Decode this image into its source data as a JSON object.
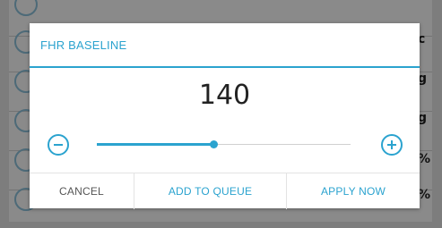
{
  "dialog": {
    "title": "FHR BASELINE",
    "value": "140",
    "slider_fraction": 0.46,
    "minus_icon": "minus-circle-icon",
    "plus_icon": "plus-circle-icon",
    "actions": {
      "cancel": "CANCEL",
      "add_to_queue": "ADD TO QUEUE",
      "apply_now": "APPLY NOW"
    }
  },
  "background": {
    "units": [
      "c",
      "g",
      "g",
      "%",
      "%"
    ]
  },
  "colors": {
    "accent": "#2ba3cf",
    "dim_overlay": "#7d7d7d",
    "text_dark": "#222222",
    "text_muted": "#555555"
  }
}
